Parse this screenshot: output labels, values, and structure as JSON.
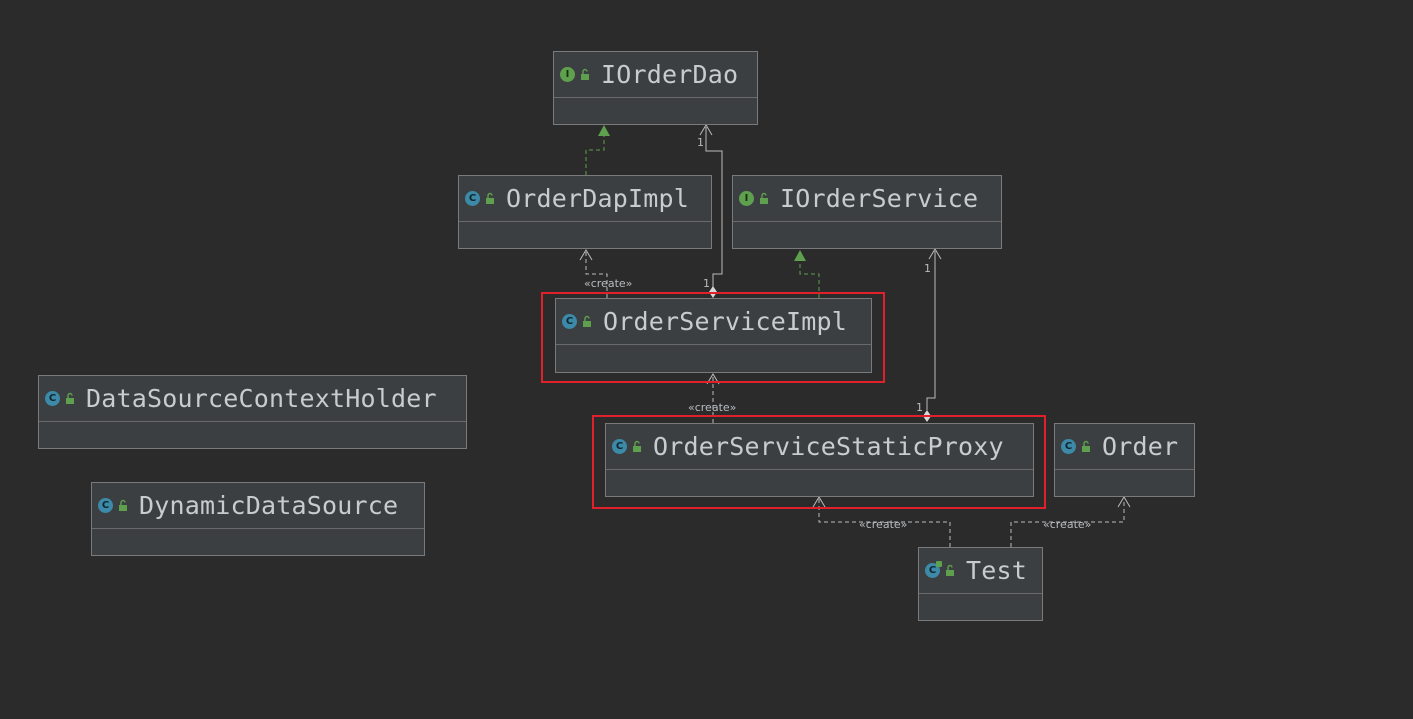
{
  "nodes": {
    "iorderdao": {
      "name": "IOrderDao",
      "kind": "interface"
    },
    "orderdapimpl": {
      "name": "OrderDapImpl",
      "kind": "class"
    },
    "iorderservice": {
      "name": "IOrderService",
      "kind": "interface"
    },
    "orderserviceimpl": {
      "name": "OrderServiceImpl",
      "kind": "class"
    },
    "datasourcecontextholder": {
      "name": "DataSourceContextHolder",
      "kind": "class"
    },
    "dynamicdatasource": {
      "name": "DynamicDataSource",
      "kind": "class"
    },
    "orderservicestaticproxy": {
      "name": "OrderServiceStaticProxy",
      "kind": "class"
    },
    "order": {
      "name": "Order",
      "kind": "class"
    },
    "test": {
      "name": "Test",
      "kind": "main-class"
    }
  },
  "edge_labels": {
    "create": "«create»",
    "one": "1"
  },
  "highlighted": [
    "OrderServiceImpl",
    "OrderServiceStaticProxy"
  ],
  "colors": {
    "background": "#2b2b2b",
    "node_fill": "#3c3f41",
    "node_border": "#7a7a7a",
    "node_text": "#c8ccd0",
    "class_badge": "#3d8aa8",
    "interface_badge": "#5fa04e",
    "realization_arrow": "#5fa04e",
    "dependency_line": "#bbbbbb",
    "highlight_box": "#e0202a"
  }
}
